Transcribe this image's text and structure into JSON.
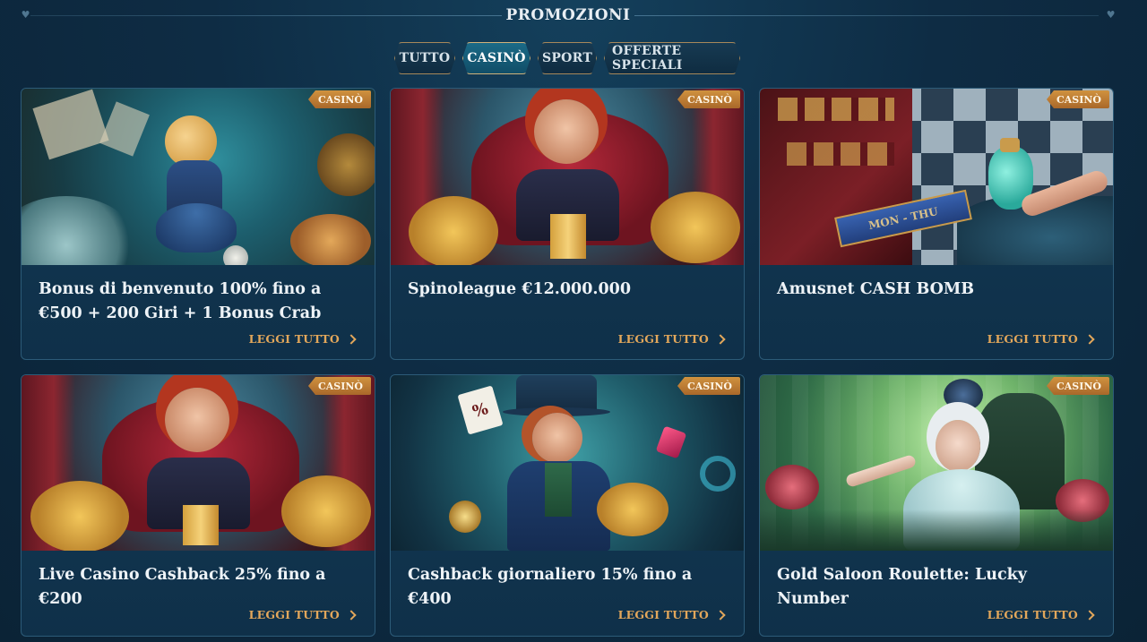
{
  "header": {
    "title": "PROMOZIONI"
  },
  "tabs": [
    {
      "label": "TUTTO",
      "active": false
    },
    {
      "label": "CASINÒ",
      "active": true
    },
    {
      "label": "SPORT",
      "active": false
    },
    {
      "label": "OFFERTE SPECIALI",
      "active": false
    }
  ],
  "cards": [
    {
      "badge": "CASINÒ",
      "title": "Bonus di benvenuto 100% fino a €500 + 200 Giri + 1 Bonus Crab",
      "cta": "LEGGI TUTTO",
      "image": "alice-wonderland-falling"
    },
    {
      "badge": "CASINÒ",
      "title": "Spinoleague €12.000.000",
      "cta": "LEGGI TUTTO",
      "image": "queen-of-hearts-coins"
    },
    {
      "badge": "CASINÒ",
      "title": "Amusnet CASH BOMB",
      "cta": "LEGGI TUTTO",
      "image": "potion-checkerboard"
    },
    {
      "badge": "CASINÒ",
      "title": "Live Casino Cashback 25% fino a €200",
      "cta": "LEGGI TUTTO",
      "image": "queen-of-hearts-coins"
    },
    {
      "badge": "CASINÒ",
      "title": "Cashback giornaliero 15% fino a €400",
      "cta": "LEGGI TUTTO",
      "image": "mad-hatter-coins"
    },
    {
      "badge": "CASINÒ",
      "title": "Gold Saloon Roulette: Lucky Number",
      "cta": "LEGGI TUTTO",
      "image": "white-queen-garden"
    }
  ],
  "illustration_text": {
    "ribbon": "MON - THU",
    "card_symbol": "%"
  },
  "colors": {
    "background": "#0d2a40",
    "accent_gold": "#e2a75b",
    "badge": "#c0823a",
    "active_tab": "#1b6a87"
  }
}
